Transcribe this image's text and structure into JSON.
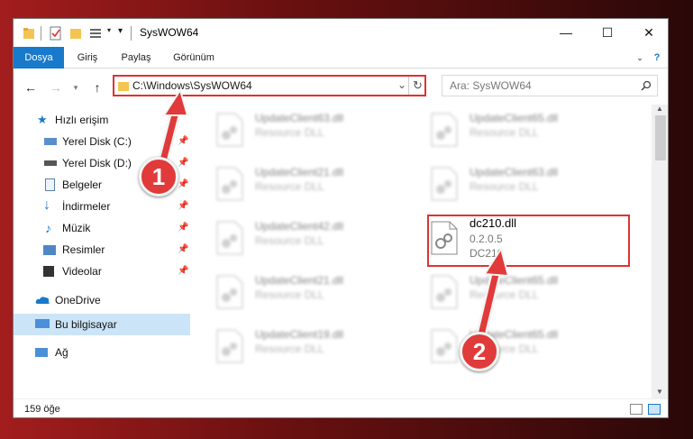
{
  "window": {
    "title": "SysWOW64"
  },
  "ribbon": {
    "tabs": [
      "Dosya",
      "Giriş",
      "Paylaş",
      "Görünüm"
    ]
  },
  "address": {
    "path": "C:\\Windows\\SysWOW64"
  },
  "search": {
    "placeholder": "Ara: SysWOW64"
  },
  "nav": {
    "quick_access": "Hızlı erişim",
    "items": [
      {
        "label": "Yerel Disk (C:)"
      },
      {
        "label": "Yerel Disk (D:)"
      },
      {
        "label": "Belgeler"
      },
      {
        "label": "İndirmeler"
      },
      {
        "label": "Müzik"
      },
      {
        "label": "Resimler"
      },
      {
        "label": "Videolar"
      }
    ],
    "onedrive": "OneDrive",
    "this_pc": "Bu bilgisayar",
    "network": "Ağ"
  },
  "files": [
    {
      "name": "UpdateClient63.dll",
      "type": "Resource DLL"
    },
    {
      "name": "UpdateClient65.dll",
      "type": "Resource DLL"
    },
    {
      "name": "UpdateClient21.dll",
      "type": "Resource DLL"
    },
    {
      "name": "UpdateClient63.dll",
      "type": "Resource DLL"
    },
    {
      "name": "UpdateClient42.dll",
      "type": "Resource DLL"
    },
    {
      "name": "dc210.dll",
      "version": "0.2.0.5",
      "desc": "DC210"
    },
    {
      "name": "UpdateClient21.dll",
      "type": "Resource DLL"
    },
    {
      "name": "UpdateClient65.dll",
      "type": "Resource DLL"
    },
    {
      "name": "UpdateClient19.dll",
      "type": "Resource DLL"
    },
    {
      "name": "UpdateClient65.dll",
      "type": "Resource DLL"
    }
  ],
  "status": {
    "count": "159 öğe"
  },
  "markers": {
    "one": "1",
    "two": "2"
  },
  "colors": {
    "accent": "#1979ca",
    "highlight": "#d33333",
    "marker": "#e03a3a"
  }
}
